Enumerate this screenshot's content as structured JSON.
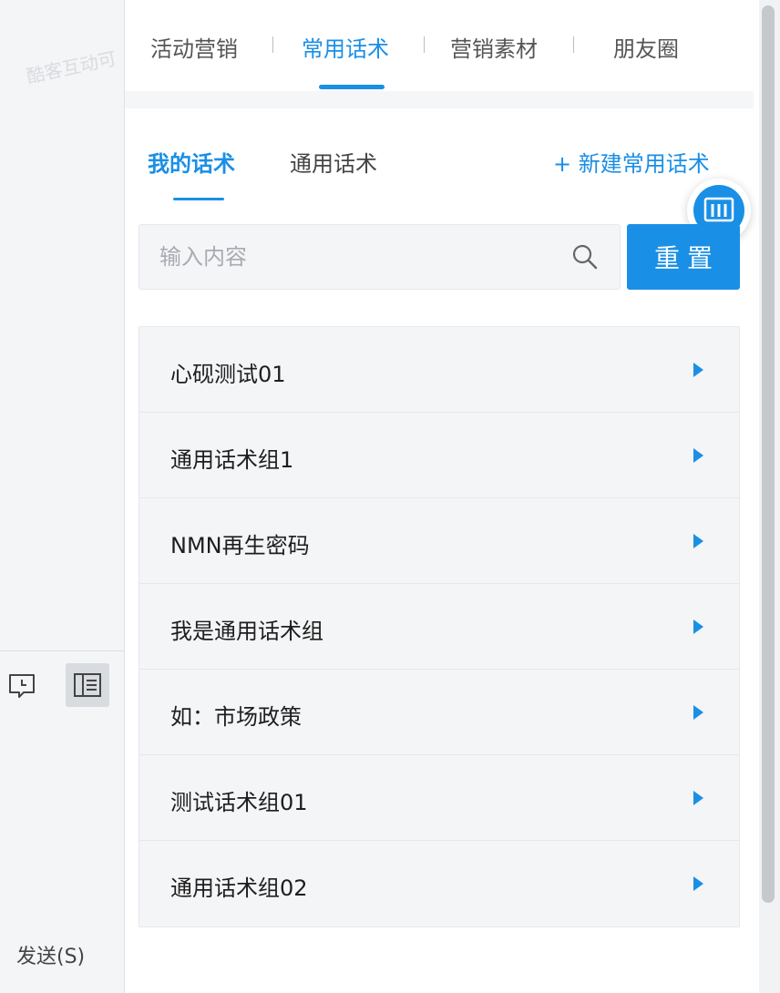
{
  "left_pane": {
    "watermark": "酷客互动可",
    "message_icon": "chat-clock-icon",
    "panel_icon": "list-panel-icon",
    "send_label": "发送(S)"
  },
  "top_tabs": [
    {
      "label": "活动营销",
      "active": false
    },
    {
      "label": "常用话术",
      "active": true
    },
    {
      "label": "营销素材",
      "active": false
    },
    {
      "label": "朋友圈",
      "active": false
    }
  ],
  "sub_tabs": [
    {
      "label": "我的话术",
      "active": true
    },
    {
      "label": "通用话术",
      "active": false
    }
  ],
  "new_script_link": "+ 新建常用话术",
  "float_button_icon": "bar-chart-icon",
  "search": {
    "placeholder": "输入内容",
    "value": "",
    "icon": "search-icon"
  },
  "reset_button": "重置",
  "groups": [
    {
      "label": "心砚测试01"
    },
    {
      "label": "通用话术组1"
    },
    {
      "label": "NMN再生密码"
    },
    {
      "label": "我是通用话术组"
    },
    {
      "label": "如：市场政策"
    },
    {
      "label": "测试话术组01"
    },
    {
      "label": "通用话术组02"
    }
  ],
  "colors": {
    "accent": "#1a8fe6",
    "panel_bg": "#f4f5f7"
  }
}
